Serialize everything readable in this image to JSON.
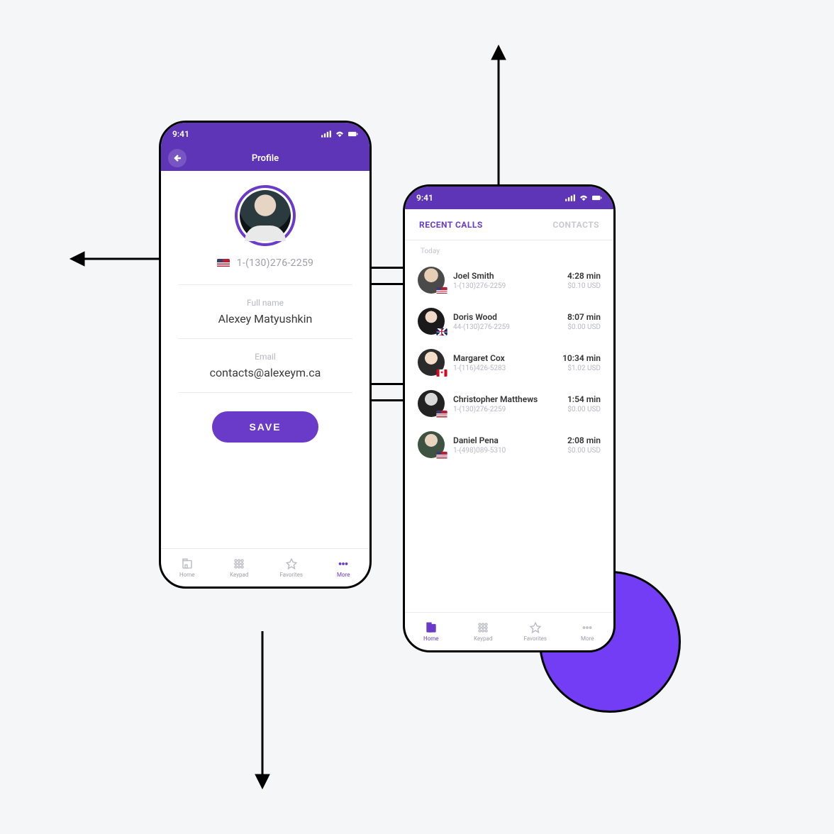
{
  "colors": {
    "purple": "#6a3ac9"
  },
  "status": {
    "time": "9:41"
  },
  "profile": {
    "title": "Profile",
    "phone": "1-(130)276-2259",
    "flag": "us",
    "fields": {
      "fullname_label": "Full name",
      "fullname_value": "Alexey Matyushkin",
      "email_label": "Email",
      "email_value": "contacts@alexeym.ca"
    },
    "save_label": "SAVE"
  },
  "tabs": {
    "home": "Home",
    "keypad": "Keypad",
    "favorites": "Favorites",
    "more": "More"
  },
  "calls": {
    "tab_recent": "RECENT CALLS",
    "tab_contacts": "CONTACTS",
    "section": "Today",
    "items": [
      {
        "name": "Joel Smith",
        "phone": "1-(130)276-2259",
        "duration": "4:28 min",
        "cost": "$0.10 USD",
        "flag": "us"
      },
      {
        "name": "Doris Wood",
        "phone": "44-(130)276-2259",
        "duration": "8:07 min",
        "cost": "$0.00 USD",
        "flag": "uk"
      },
      {
        "name": "Margaret Cox",
        "phone": "1-(116)426-5283",
        "duration": "10:34 min",
        "cost": "$1.02 USD",
        "flag": "ca"
      },
      {
        "name": "Christopher Matthews",
        "phone": "1-(130)276-2259",
        "duration": "1:54 min",
        "cost": "$0.00 USD",
        "flag": "us"
      },
      {
        "name": "Daniel Pena",
        "phone": "1-(498)089-5310",
        "duration": "2:08 min",
        "cost": "$0.00 USD",
        "flag": "us"
      }
    ]
  }
}
